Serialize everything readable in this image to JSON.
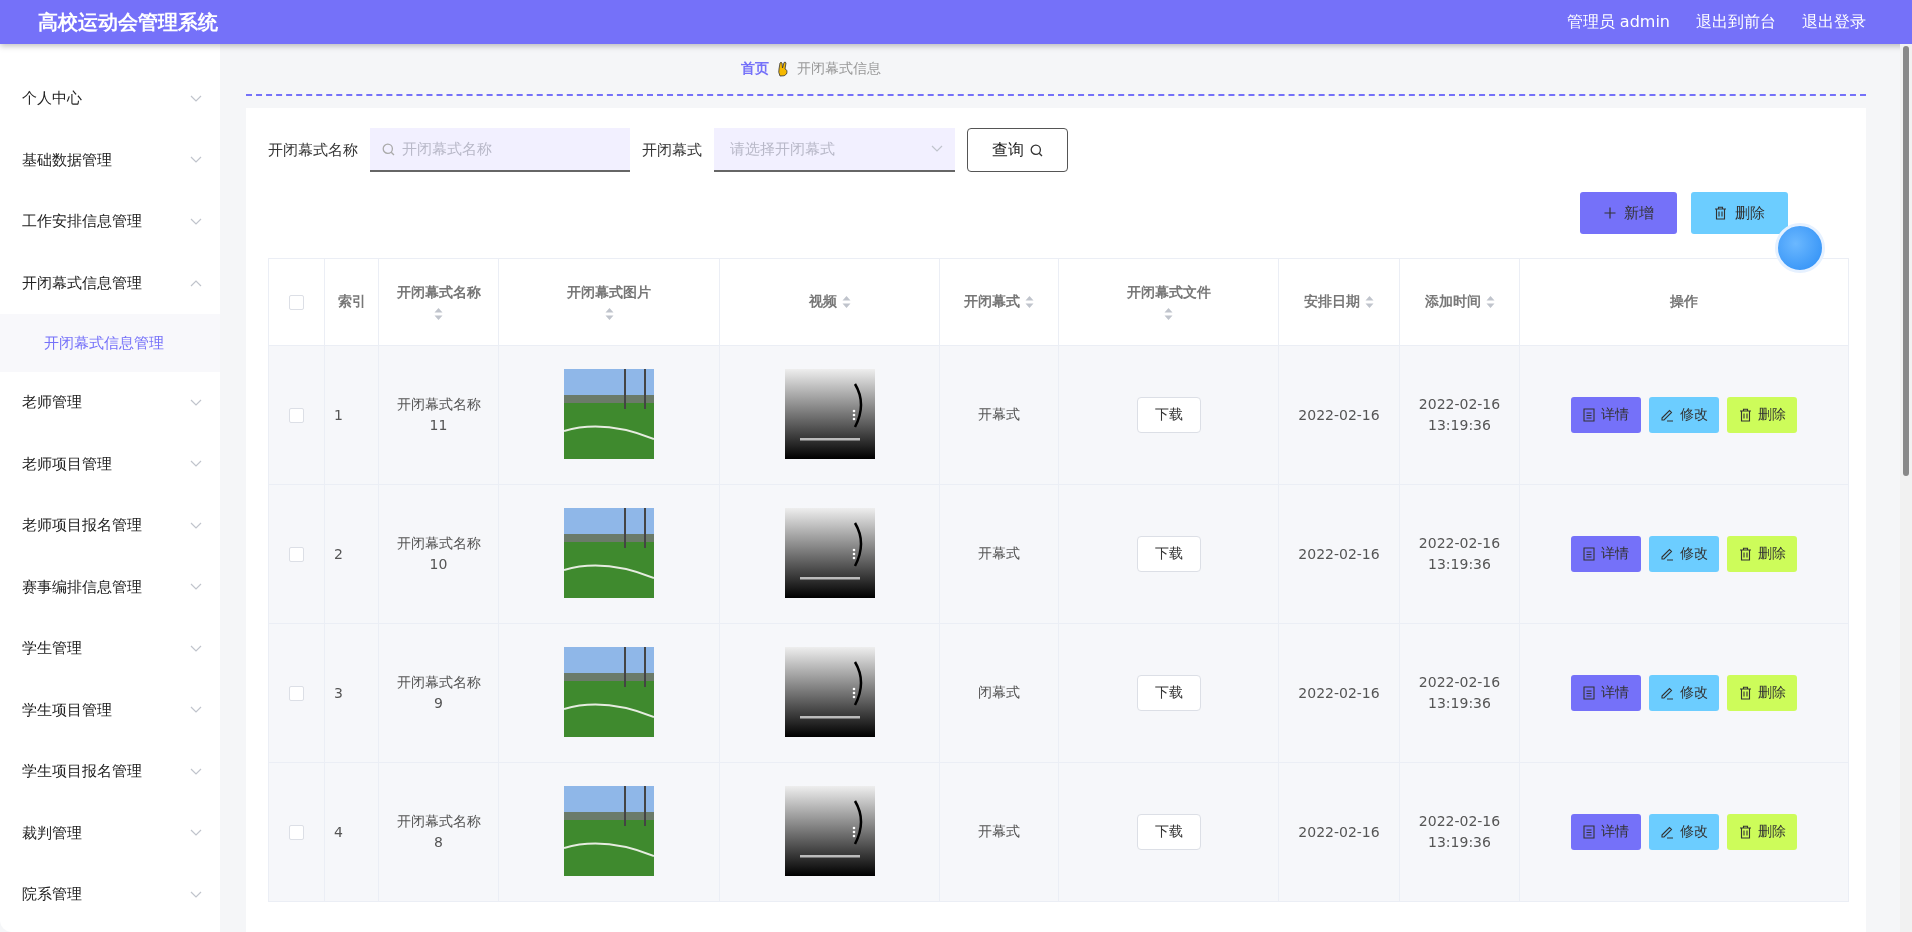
{
  "header": {
    "title": "高校运动会管理系统",
    "links": [
      "管理员 admin",
      "退出到前台",
      "退出登录"
    ]
  },
  "sidebar": {
    "items": [
      {
        "label": "个人中心",
        "expanded": false
      },
      {
        "label": "基础数据管理",
        "expanded": false
      },
      {
        "label": "工作安排信息管理",
        "expanded": false
      },
      {
        "label": "开闭幕式信息管理",
        "expanded": true,
        "children": [
          {
            "label": "开闭幕式信息管理",
            "selected": true
          }
        ]
      },
      {
        "label": "老师管理",
        "expanded": false
      },
      {
        "label": "老师项目管理",
        "expanded": false
      },
      {
        "label": "老师项目报名管理",
        "expanded": false
      },
      {
        "label": "赛事编排信息管理",
        "expanded": false
      },
      {
        "label": "学生管理",
        "expanded": false
      },
      {
        "label": "学生项目管理",
        "expanded": false
      },
      {
        "label": "学生项目报名管理",
        "expanded": false
      },
      {
        "label": "裁判管理",
        "expanded": false
      },
      {
        "label": "院系管理",
        "expanded": false
      }
    ]
  },
  "breadcrumb": [
    "首页",
    "开闭幕式信息"
  ],
  "search": {
    "name_label": "开闭幕式名称",
    "name_placeholder": "开闭幕式名称",
    "type_label": "开闭幕式",
    "type_placeholder": "请选择开闭幕式",
    "button": "查询"
  },
  "actions": {
    "add": "新增",
    "delete": "删除"
  },
  "table": {
    "select_all_checked": false,
    "columns": [
      {
        "label": "索引",
        "sortable": false
      },
      {
        "label": "开闭幕式名称",
        "sortable": true
      },
      {
        "label": "开闭幕式图片",
        "sortable": true
      },
      {
        "label": "视频",
        "sortable": true
      },
      {
        "label": "开闭幕式",
        "sortable": true
      },
      {
        "label": "开闭幕式文件",
        "sortable": true
      },
      {
        "label": "安排日期",
        "sortable": true
      },
      {
        "label": "添加时间",
        "sortable": true
      },
      {
        "label": "操作",
        "sortable": false
      }
    ],
    "rows": [
      {
        "checked": false,
        "index": "1",
        "name": "开闭幕式名称11",
        "type": "开幕式",
        "file": "下载",
        "date": "2022-02-16",
        "added": "2022-02-16 13:19:36",
        "ops": [
          "详情",
          "修改",
          "删除"
        ]
      },
      {
        "checked": false,
        "index": "2",
        "name": "开闭幕式名称10",
        "type": "开幕式",
        "file": "下载",
        "date": "2022-02-16",
        "added": "2022-02-16 13:19:36",
        "ops": [
          "详情",
          "修改",
          "删除"
        ]
      },
      {
        "checked": false,
        "index": "3",
        "name": "开闭幕式名称9",
        "type": "闭幕式",
        "file": "下载",
        "date": "2022-02-16",
        "added": "2022-02-16 13:19:36",
        "ops": [
          "详情",
          "修改",
          "删除"
        ]
      },
      {
        "checked": false,
        "index": "4",
        "name": "开闭幕式名称8",
        "type": "开幕式",
        "file": "下载",
        "date": "2022-02-16",
        "added": "2022-02-16 13:19:36",
        "ops": [
          "详情",
          "修改",
          "删除"
        ]
      }
    ]
  }
}
